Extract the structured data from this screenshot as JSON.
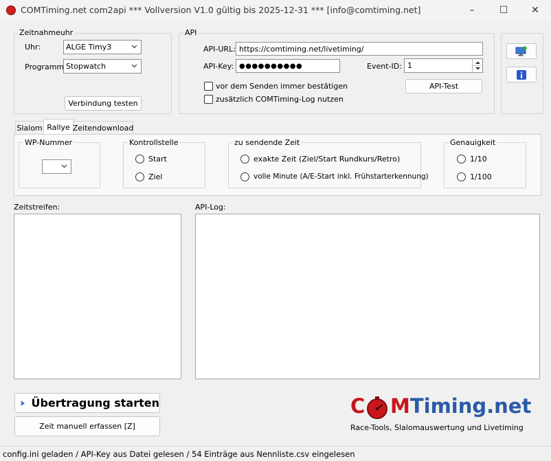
{
  "window": {
    "title": "COMTiming.net com2api *** Vollversion V1.0 gültig bis 2025-12-31 *** [info@comtiming.net]",
    "minimize_glyph": "–",
    "maximize_glyph": "☐",
    "close_glyph": "✕"
  },
  "zeitnahmeuhr": {
    "title": "Zeitnahmeuhr",
    "uhr_label": "Uhr:",
    "uhr_value": "ALGE Timy3",
    "programm_label": "Programm:",
    "programm_value": "Stopwatch",
    "test_button": "Verbindung testen"
  },
  "api": {
    "title": "API",
    "url_label": "API-URL:",
    "url_value": "https://comtiming.net/livetiming/",
    "key_label": "API-Key:",
    "key_value": "●●●●●●●●●●",
    "event_label": "Event-ID:",
    "event_value": "1",
    "confirm_label": "vor dem Senden immer bestätigen",
    "log_label": "zusätzlich COMTiming-Log nutzen",
    "test_button": "API-Test"
  },
  "side_buttons": {
    "top_icon": "monitor-add-icon",
    "bottom_icon": "info-icon"
  },
  "tabs": [
    {
      "label": "Slalom",
      "active": false
    },
    {
      "label": "Rallye",
      "active": true
    },
    {
      "label": "Zeitendownload",
      "active": false
    }
  ],
  "rallye": {
    "wp_title": "WP-Nummer",
    "wp_value": "",
    "kontroll_title": "Kontrollstelle",
    "kontroll_options": [
      "Start",
      "Ziel"
    ],
    "zeit_title": "zu sendende Zeit",
    "zeit_options": [
      "exakte Zeit (Ziel/Start Rundkurs/Retro)",
      "volle Minute (A/E-Start inkl. Frühstarterkennung)"
    ],
    "genau_title": "Genauigkeit",
    "genau_options": [
      "1/10",
      "1/100"
    ]
  },
  "zeitstreifen_label": "Zeitstreifen:",
  "apilog_label": "API-Log:",
  "start_button": "Übertragung starten",
  "manual_button": "Zeit manuell erfassen [Z]",
  "logo": {
    "prefix": "C",
    "middle": "MTiming.net",
    "tagline": "Race-Tools, Slalomauswertung und Livetiming",
    "red": "#c8161d",
    "blue": "#2b5aa8"
  },
  "status": "config.ini geladen / API-Key aus Datei gelesen / 54 Einträge aus Nennliste.csv eingelesen"
}
